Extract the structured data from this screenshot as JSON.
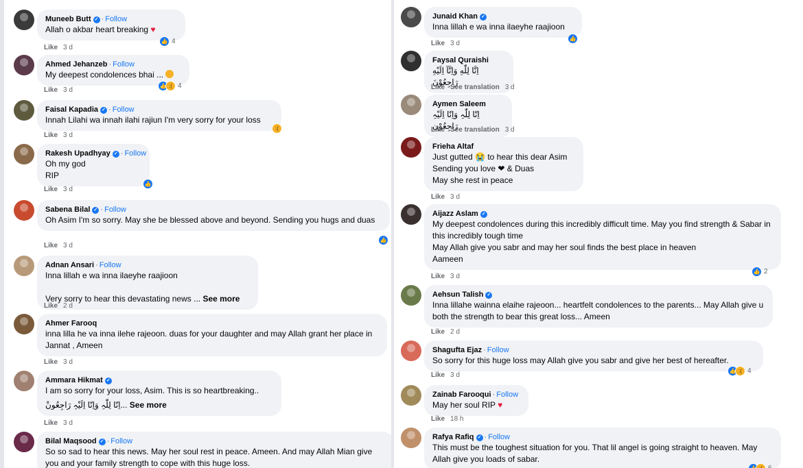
{
  "left_comments": [
    {
      "name": "Muneeb Butt",
      "verified": true,
      "follow": "Follow",
      "text": "Allah o akbar heart breaking",
      "emoji": "heart",
      "meta": {
        "like": "Like",
        "time": "3 d"
      },
      "reactions": {
        "types": [
          "like"
        ],
        "count": "4"
      }
    },
    {
      "name": "Ahmed Jehanzeb",
      "verified": false,
      "follow": "Follow",
      "text": "My deepest condolences bhai ...",
      "emoji": "face",
      "meta": {
        "like": "Like",
        "time": "3 d"
      },
      "reactions": {
        "types": [
          "like",
          "sad"
        ],
        "count": "4"
      }
    },
    {
      "name": "Faisal Kapadia",
      "verified": true,
      "follow": "Follow",
      "text": "Innah Lilahi wa innah ilahi rajiun I'm very sorry for your loss",
      "meta": {
        "like": "Like",
        "time": "3 d"
      },
      "reactions": {
        "types": [
          "sad"
        ],
        "count": ""
      }
    },
    {
      "name": "Rakesh Upadhyay",
      "verified": true,
      "follow": "Follow",
      "text": "Oh my god\nRIP",
      "meta": {
        "like": "Like",
        "time": "3 d"
      },
      "reactions": {
        "types": [
          "like"
        ],
        "count": ""
      }
    },
    {
      "name": "Sabena Bilal",
      "verified": true,
      "follow": "Follow",
      "text": "Oh Asim I'm so sorry. May she be blessed above and beyond. Sending you hugs and duas",
      "meta": {
        "like": "Like",
        "time": "3 d"
      },
      "reactions": {
        "types": [
          "like"
        ],
        "count": ""
      }
    },
    {
      "name": "Adnan Ansari",
      "verified": false,
      "follow": "Follow",
      "text": "Inna lillah e wa inna ilaeyhe raajioon\n\nVery sorry to hear this devastating news ...",
      "see_more": "See more",
      "meta": {
        "like": "Like",
        "time": "2 d"
      }
    },
    {
      "name": "Ahmer Farooq",
      "verified": false,
      "follow": "",
      "text": "inna lilla he va inna ilehe rajeoon. duas for your daughter and may Allah grant her place in Jannat , Ameen",
      "meta": {
        "like": "Like",
        "time": "3 d"
      }
    },
    {
      "name": "Ammara Hikmat",
      "verified": true,
      "follow": "",
      "text": "I am so sorry for your loss, Asim. This is so heartbreaking..",
      "text2": "...اِنّا لِلّٰہِ وَاِنّا اِلَیْہِ رَاجِعُونْ",
      "see_more": "See more",
      "meta": {
        "like": "Like",
        "time": "3 d"
      }
    },
    {
      "name": "Bilal Maqsood",
      "verified": true,
      "follow": "Follow",
      "text": "So so sad to hear this news. May her soul rest in peace. Ameen. And may Allah Mian give you and your family strength to cope with this huge loss."
    }
  ],
  "right_comments": [
    {
      "name": "Junaid Khan",
      "verified": true,
      "follow": "",
      "text": "Inna lillah e wa inna ilaeyhe raajioon",
      "meta": {
        "like": "Like",
        "time": "3 d"
      },
      "reactions": {
        "types": [
          "like"
        ],
        "count": ""
      }
    },
    {
      "name": "Faysal Quraishi",
      "verified": false,
      "follow": "",
      "text": "اِنَّا لِلّٰهِ وَاِنَّآ اِلَيْهِ رَاجِعُوْنَ",
      "meta": {
        "like": "Like",
        "see_translation": "See translation",
        "time": "3 d"
      }
    },
    {
      "name": "Aymen Saleem",
      "verified": false,
      "follow": "",
      "text": "اِنّا لِلّٰہِ وَاِنّا اِلَیْہِ رَاجِعُوْن",
      "meta": {
        "like": "Like",
        "see_translation": "See translation",
        "time": "3 d"
      }
    },
    {
      "name": "Frieha Altaf",
      "verified": false,
      "follow": "",
      "text": "Just gutted 😭 to hear this dear Asim\nSending you love ❤ & Duas\nMay she rest in peace",
      "meta": {
        "like": "Like",
        "time": "3 d"
      }
    },
    {
      "name": "Aijazz Aslam",
      "verified": true,
      "follow": "",
      "text": "My deepest condolences during this incredibly difficult time. May you find strength & Sabar in this incredibly tough time\nMay Allah give you sabr and may her soul finds the best place in heaven\nAameen",
      "meta": {
        "like": "Like",
        "time": "3 d"
      },
      "reactions": {
        "types": [
          "like"
        ],
        "count": "2"
      }
    },
    {
      "name": "Aehsun Talish",
      "verified": true,
      "follow": "",
      "text": "Inna lillahe wainna elaihe rajeoon... heartfelt condolences to the parents... May Allah give u both the strength to bear this great loss... Ameen",
      "meta": {
        "like": "Like",
        "time": "2 d"
      }
    },
    {
      "name": "Shagufta Ejaz",
      "verified": false,
      "follow": "Follow",
      "text": "So sorry for this huge loss may Allah give you sabr and give her best of hereafter.",
      "meta": {
        "like": "Like",
        "time": "3 d"
      },
      "reactions": {
        "types": [
          "like",
          "sad"
        ],
        "count": "4"
      }
    },
    {
      "name": "Zainab Farooqui",
      "verified": false,
      "follow": "Follow",
      "text": "May her soul RIP",
      "emoji": "heart",
      "meta": {
        "like": "Like",
        "time": "18 h"
      }
    },
    {
      "name": "Rafya Rafiq",
      "verified": true,
      "follow": "Follow",
      "text": "This must be the toughest situation for you. That lil angel is going straight to heaven. May Allah give you loads of sabar.",
      "reactions": {
        "types": [
          "like",
          "sad"
        ],
        "count": "6"
      }
    }
  ],
  "avatar_colors": {
    "left": [
      "#3a3a3a",
      "#5b3b4a",
      "#5d5a3e",
      "#8a6a4a",
      "#c84b2f",
      "#b89a7a",
      "#7a5a3a",
      "#a08070",
      "#6a2a4a"
    ],
    "right": [
      "#4a4a4a",
      "#2f2f2f",
      "#9a8a7a",
      "#7a1a1a",
      "#3a3030",
      "#6a7a4a",
      "#d86a5a",
      "#a08a5a",
      "#c0906a"
    ]
  }
}
